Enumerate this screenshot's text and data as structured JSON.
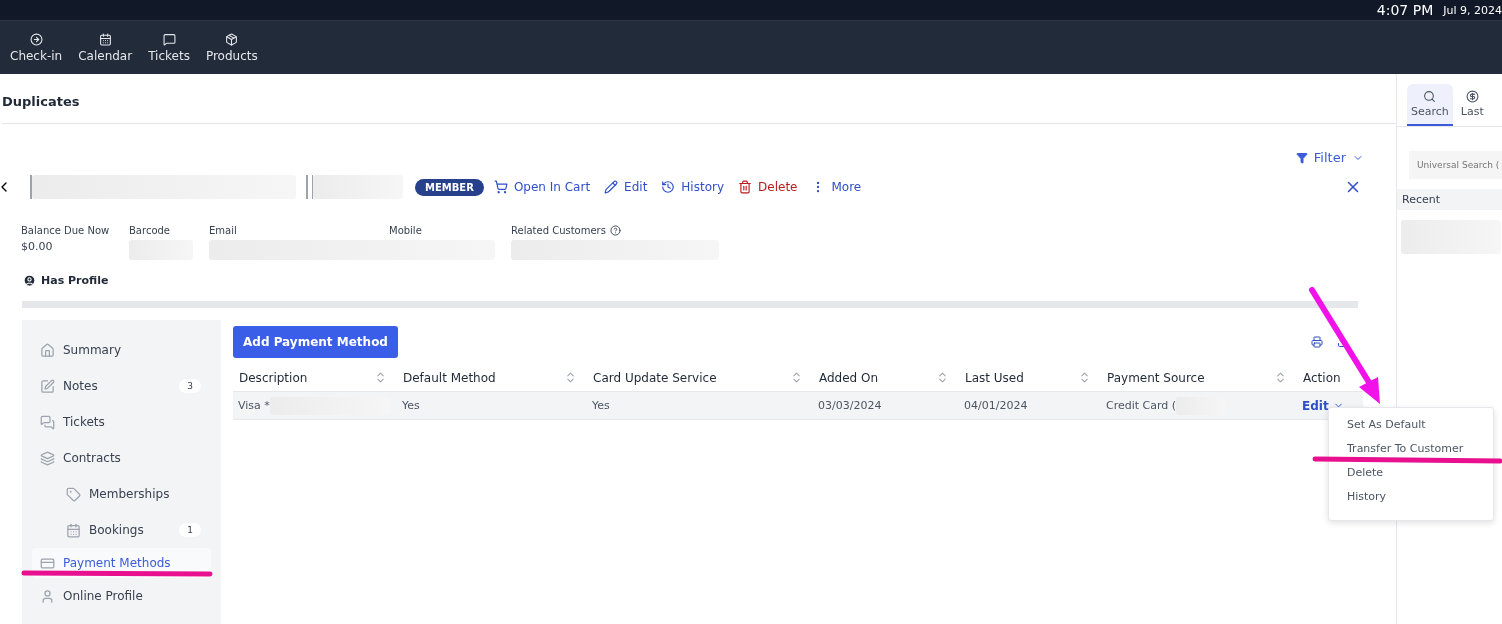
{
  "status_bar": {
    "time": "4:07 PM",
    "date": "Jul 9, 2024"
  },
  "nav": [
    {
      "label": "Check-in"
    },
    {
      "label": "Calendar"
    },
    {
      "label": "Tickets"
    },
    {
      "label": "Products"
    }
  ],
  "page_title": "Duplicates",
  "filter": {
    "label": "Filter"
  },
  "customer": {
    "badge": "MEMBER",
    "actions": [
      {
        "label": "Open In Cart",
        "kind": "normal"
      },
      {
        "label": "Edit",
        "kind": "normal"
      },
      {
        "label": "History",
        "kind": "normal"
      },
      {
        "label": "Delete",
        "kind": "danger"
      },
      {
        "label": "More",
        "kind": "normal"
      }
    ],
    "fields": [
      {
        "label": "Balance Due Now",
        "value": "$0.00"
      },
      {
        "label": "Barcode"
      },
      {
        "label": "Email"
      },
      {
        "label": "Mobile"
      },
      {
        "label": "Related Customers"
      }
    ],
    "profile": "Has Profile"
  },
  "sidebar": {
    "items": [
      {
        "label": "Summary",
        "selected": false
      },
      {
        "label": "Notes",
        "badge": "3",
        "selected": false
      },
      {
        "label": "Tickets",
        "selected": false
      },
      {
        "label": "Contracts",
        "selected": false,
        "children": [
          {
            "label": "Memberships",
            "selected": false
          },
          {
            "label": "Bookings",
            "badge": "1",
            "selected": false
          }
        ]
      },
      {
        "label": "Payment Methods",
        "selected": true
      },
      {
        "label": "Online Profile",
        "selected": false
      }
    ]
  },
  "add_button": "Add Payment Method",
  "table": {
    "columns": [
      "Description",
      "Default Method",
      "Card Update Service",
      "Added On",
      "Last Used",
      "Payment Source",
      "Action"
    ],
    "rows": [
      {
        "cells": [
          "Visa *",
          "Yes",
          "Yes",
          "03/03/2024",
          "04/01/2024",
          "Credit Card ("
        ],
        "action": "Edit"
      }
    ]
  },
  "action_menu": {
    "items": [
      "Set As Default",
      "Transfer To Customer",
      "Delete",
      "History"
    ]
  },
  "right_panel": {
    "tabs": [
      {
        "label": "Search",
        "selected": true
      },
      {
        "label": "Last",
        "selected": false
      }
    ],
    "search": {
      "placeholder": "Universal Search ("
    },
    "recent": "Recent"
  }
}
